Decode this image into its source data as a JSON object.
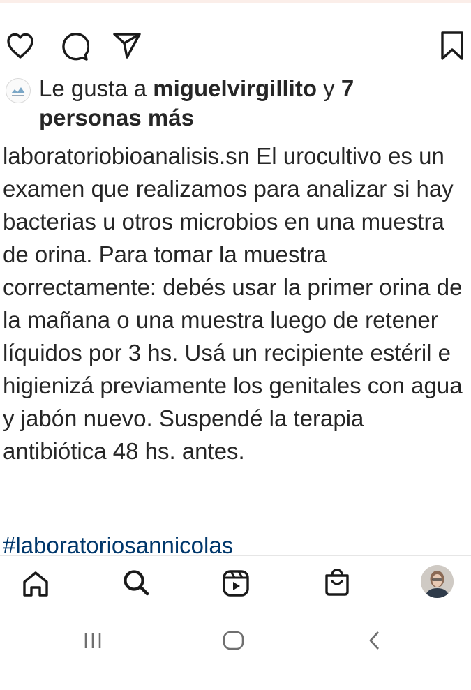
{
  "likes": {
    "prefix": "Le gusta a ",
    "user": "miguelvirgillito",
    "middle": " y ",
    "others": "7 personas más"
  },
  "caption": {
    "username": "laboratoriobioanalisis.sn",
    "text": " El urocultivo es un examen que realizamos para analizar si hay bacterias u otros microbios en una muestra de orina. Para tomar la muestra correctamente: debés usar la primer orina de la mañana o una muestra luego de retener líquidos por 3 hs. Usá un recipiente estéril e higienizá previamente los genitales con agua y jabón nuevo. Suspendé la terapia antibiótica 48 hs. antes.",
    "hashtag": "#laboratoriosannicolas"
  },
  "icons": {
    "actions": [
      "heart-icon",
      "comment-icon",
      "share-icon",
      "bookmark-icon"
    ],
    "nav": [
      "home-icon",
      "search-icon",
      "reels-icon",
      "shop-icon",
      "profile-avatar"
    ],
    "system": [
      "recent-apps-icon",
      "home-circle-icon",
      "back-icon"
    ]
  },
  "colors": {
    "text": "#262626",
    "hashtag": "#00376b",
    "divider": "#e6e6e6"
  }
}
